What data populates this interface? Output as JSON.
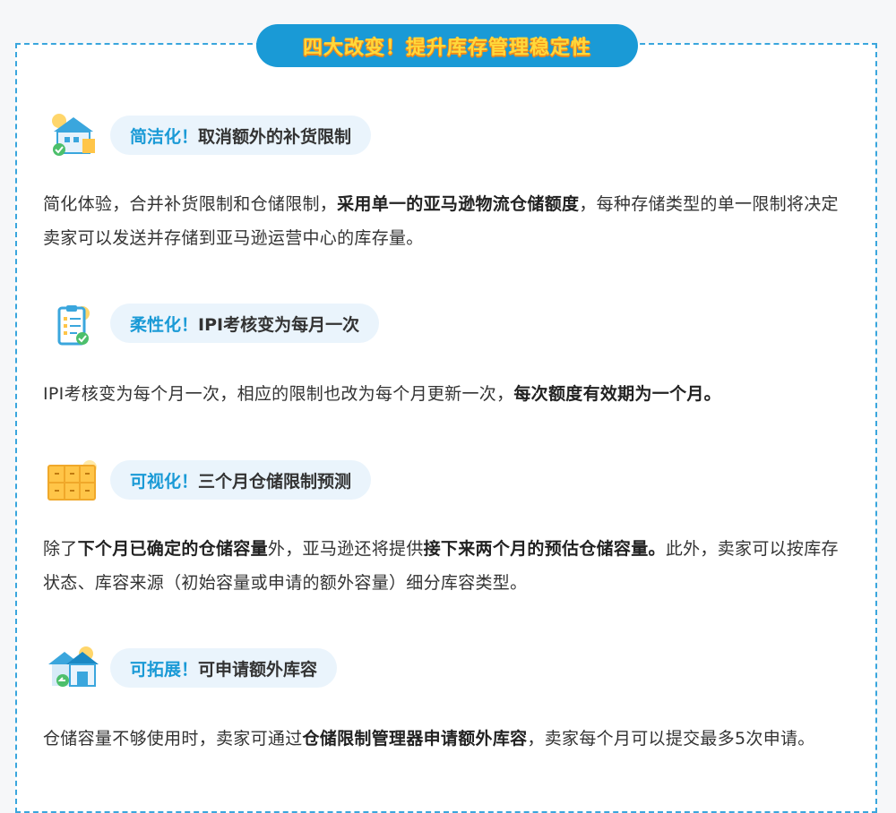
{
  "banner": {
    "title": "四大改变！提升库存管理稳定性"
  },
  "sections": [
    {
      "icon": "house-warehouse-icon",
      "tag": "简洁化！",
      "heading": "取消额外的补货限制",
      "p1": "简化体验，合并补货限制和仓储限制，",
      "b1": "采用单一的亚马逊物流仓储额度",
      "p2": "，每种存储类型的单一限制将决定卖家可以发送并存储到亚马逊运营中心的库存量。",
      "b2": "",
      "p3": ""
    },
    {
      "icon": "clipboard-check-icon",
      "tag": "柔性化！",
      "heading": "IPI考核变为每月一次",
      "p1": "IPI考核变为每个月一次，相应的限制也改为每个月更新一次，",
      "b1": "每次额度有效期为一个月。",
      "p2": "",
      "b2": "",
      "p3": ""
    },
    {
      "icon": "storage-boxes-icon",
      "tag": "可视化！",
      "heading": "三个月仓储限制预测",
      "p1": "除了",
      "b1": "下个月已确定的仓储容量",
      "p2": "外，亚马逊还将提供",
      "b2": "接下来两个月的预估仓储容量。",
      "p3": "此外，卖家可以按库存状态、库容来源（初始容量或申请的额外容量）细分库容类型。"
    },
    {
      "icon": "warehouse-expand-icon",
      "tag": "可拓展！",
      "heading": "可申请额外库容",
      "p1": "仓储容量不够使用时，卖家可通过",
      "b1": "仓储限制管理器申请额外库容",
      "p2": "，卖家每个月可以提交最多5次申请。",
      "b2": "",
      "p3": ""
    }
  ]
}
